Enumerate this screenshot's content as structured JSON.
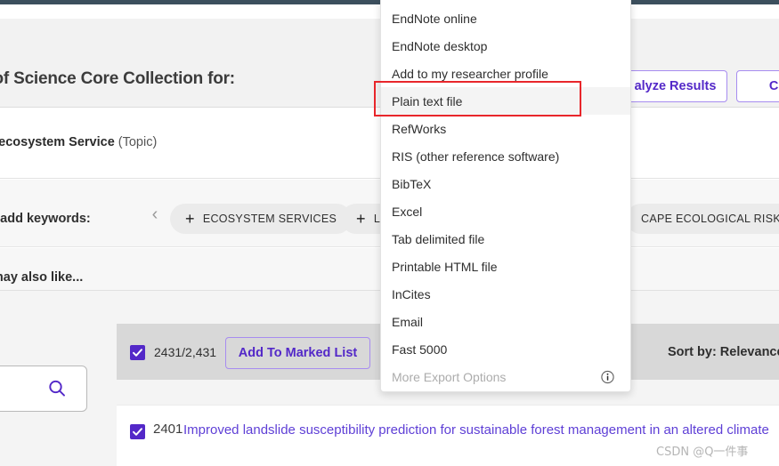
{
  "header": {
    "title": "b of Science Core Collection for:",
    "buttons": [
      {
        "name": "analyze-results",
        "label": "alyze Results"
      },
      {
        "name": "citation-report",
        "label": "Citati"
      }
    ]
  },
  "query": {
    "prefix": "nd ",
    "term": "ecosystem Service",
    "field": " (Topic)"
  },
  "keywords": {
    "label": "ick add keywords:",
    "prev_arrow": "‹",
    "chips": [
      {
        "plus": "+",
        "label": "ECOSYSTEM SERVICES"
      },
      {
        "plus": "+",
        "label": "L"
      },
      {
        "plus": "",
        "label": "CAPE ECOLOGICAL RISK ASSE"
      }
    ]
  },
  "also_like": {
    "label": "u may also like..."
  },
  "search_panel": {
    "icon": "search-icon"
  },
  "results_toolbar": {
    "selected_count": "2431/2,431",
    "add_to_marked_list": "Add To Marked List",
    "sort_by": "Sort by: Relevance"
  },
  "result": {
    "index": "2401",
    "title": "Improved landslide susceptibility prediction for sustainable forest management in an altered climate"
  },
  "watermark": "CSDN @Q一件事",
  "export_menu": {
    "items": [
      {
        "label": "EndNote online",
        "state": "normal"
      },
      {
        "label": "EndNote desktop",
        "state": "normal"
      },
      {
        "label": "Add to my researcher profile",
        "state": "normal"
      },
      {
        "label": "Plain text file",
        "state": "highlighted"
      },
      {
        "label": "RefWorks",
        "state": "normal"
      },
      {
        "label": "RIS (other reference software)",
        "state": "normal"
      },
      {
        "label": "BibTeX",
        "state": "normal"
      },
      {
        "label": "Excel",
        "state": "normal"
      },
      {
        "label": "Tab delimited file",
        "state": "normal"
      },
      {
        "label": "Printable HTML file",
        "state": "normal"
      },
      {
        "label": "InCites",
        "state": "normal"
      },
      {
        "label": "Email",
        "state": "normal"
      },
      {
        "label": "Fast 5000",
        "state": "normal"
      },
      {
        "label": "More Export Options",
        "state": "disabled",
        "icon": "info-icon"
      }
    ]
  },
  "colors": {
    "accent_purple": "#5328c8",
    "link_purple": "#5e3fd6",
    "highlight_red": "#e8262b",
    "topbar": "#3c4f5d"
  }
}
